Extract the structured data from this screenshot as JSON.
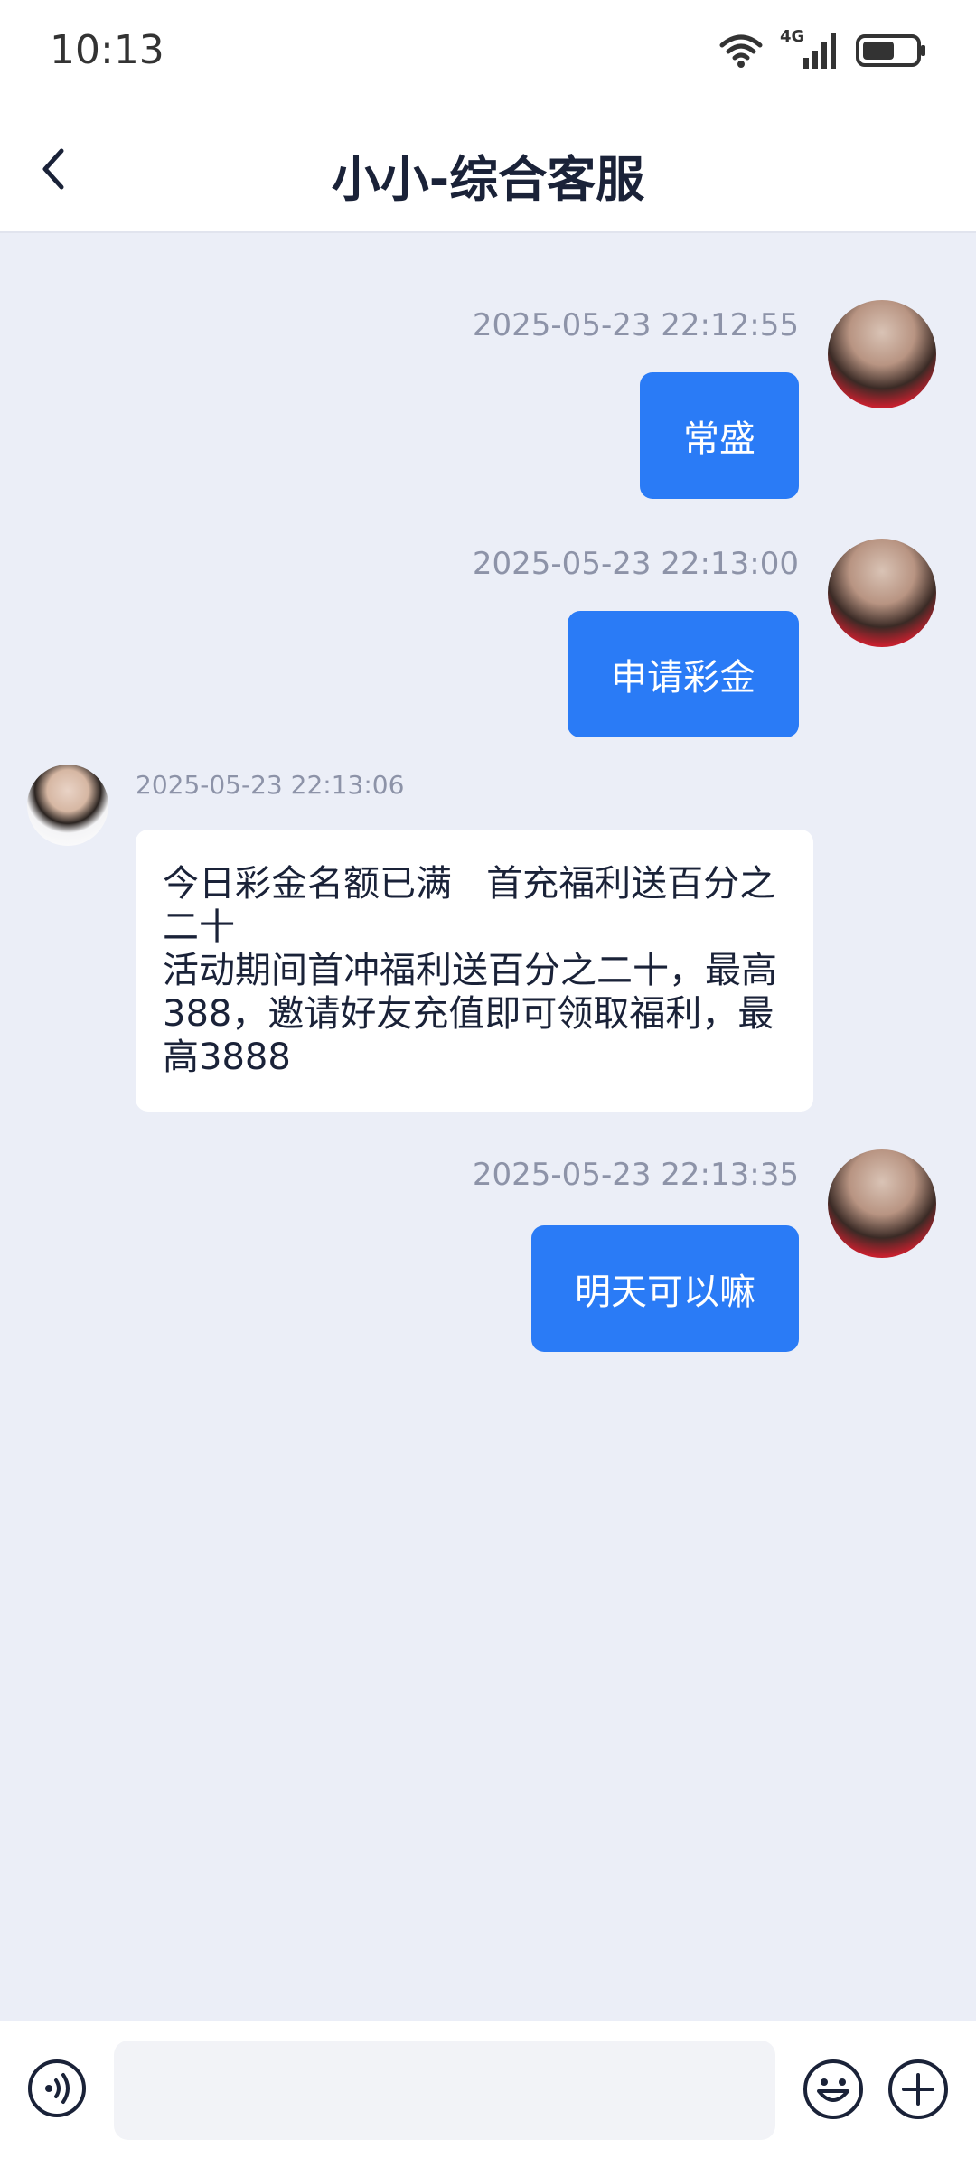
{
  "status_bar": {
    "time": "10:13",
    "network": "4G"
  },
  "header": {
    "title": "小小-综合客服"
  },
  "messages": [
    {
      "direction": "out",
      "timestamp": "2025-05-23 22:12:55",
      "text": "常盛"
    },
    {
      "direction": "out",
      "timestamp": "2025-05-23 22:13:00",
      "text": "申请彩金"
    },
    {
      "direction": "in",
      "timestamp": "2025-05-23 22:13:06",
      "text": "今日彩金名额已满   首充福利送百分之二十\n活动期间首冲福利送百分之二十，最高388，邀请好友充值即可领取福利，最高3888"
    },
    {
      "direction": "out",
      "timestamp": "2025-05-23 22:13:35",
      "text": "明天可以嘛"
    }
  ],
  "input": {
    "placeholder": ""
  },
  "colors": {
    "accent": "#2a7bf6",
    "background": "#ebeef7",
    "title": "#1a2238",
    "timestamp": "#8d93a8"
  }
}
